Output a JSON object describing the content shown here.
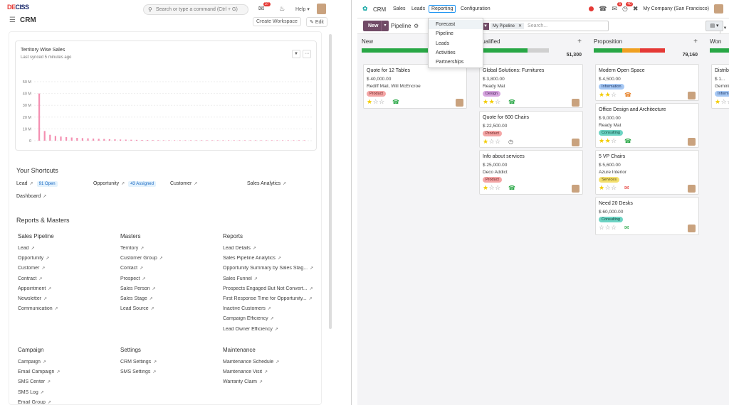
{
  "left": {
    "logo": {
      "text_a": "DE",
      "text_b": "CISS"
    },
    "search_placeholder": "Search or type a command (Ctrl + G)",
    "chat_badge": "37",
    "help_label": "Help",
    "page_title": "CRM",
    "create_workspace": "Create Workspace",
    "edit": "Edit",
    "chart": {
      "title": "Territory Wise Sales",
      "synced": "Last synced 5 minutes ago"
    },
    "shortcuts_title": "Your Shortcuts",
    "shortcuts": [
      {
        "label": "Lead",
        "badge": "91 Open"
      },
      {
        "label": "Opportunity",
        "badge": "43 Assigned"
      },
      {
        "label": "Customer"
      },
      {
        "label": "Sales Analytics"
      },
      {
        "label": "Dashboard"
      }
    ],
    "reports_title": "Reports & Masters",
    "groups": [
      {
        "title": "Sales Pipeline",
        "items": [
          "Lead",
          "Opportunity",
          "Customer",
          "Contract",
          "Appointment",
          "Newsletter",
          "Communication"
        ]
      },
      {
        "title": "Masters",
        "items": [
          "Territory",
          "Customer Group",
          "Contact",
          "Prospect",
          "Sales Person",
          "Sales Stage",
          "Lead Source"
        ]
      },
      {
        "title": "Reports",
        "items": [
          "Lead Details",
          "Sales Pipeline Analytics",
          "Opportunity Summary by Sales Stag...",
          "Sales Funnel",
          "Prospects Engaged But Not Convert...",
          "First Response Time for Opportunity...",
          "Inactive Customers",
          "Campaign Efficiency",
          "Lead Owner Efficiency"
        ]
      },
      {
        "title": "Campaign",
        "items": [
          "Campaign",
          "Email Campaign",
          "SMS Center",
          "SMS Log",
          "Email Group"
        ]
      },
      {
        "title": "Settings",
        "items": [
          "CRM Settings",
          "SMS Settings"
        ]
      },
      {
        "title": "Maintenance",
        "items": [
          "Maintenance Schedule",
          "Maintenance Visit",
          "Warranty Claim"
        ]
      }
    ]
  },
  "chart_data": {
    "type": "bar",
    "title": "Territory Wise Sales",
    "ylim": [
      0,
      50000000
    ],
    "y_ticks": [
      "50 M",
      "40 M",
      "30 M",
      "20 M",
      "10 M",
      "0"
    ],
    "values": [
      40000000,
      8200000,
      5000000,
      4000000,
      3500000,
      3000000,
      2700000,
      2400000,
      2200000,
      2000000,
      1800000,
      1600000,
      1450000,
      1300000,
      1150000,
      1000000,
      900000,
      800000,
      700000,
      620000,
      550000,
      480000,
      420000,
      370000,
      330000,
      290000,
      250000,
      220000,
      200000,
      180000,
      160000,
      140000,
      120000,
      100000,
      90000,
      80000,
      70000,
      60000,
      50000,
      45000,
      40000,
      35000,
      30000,
      25000,
      20000,
      15000,
      10000,
      8000,
      5000,
      3000
    ],
    "bar_color": "#f48fb1",
    "grid": true
  },
  "right": {
    "app": "CRM",
    "menu": [
      "Sales",
      "Leads",
      "Reporting",
      "Configuration"
    ],
    "dropdown": [
      "Forecast",
      "Pipeline",
      "Leads",
      "Activities",
      "Partnerships"
    ],
    "nav_badges": {
      "activity": "5",
      "messages": "40"
    },
    "company": "My Company (San Francisco)",
    "new": "New",
    "view_title": "Pipeline",
    "facet": "My Pipeline",
    "search_placeholder": "Search...",
    "columns": [
      {
        "name": "New",
        "total": "",
        "cards": [
          {
            "title": "Quote for 12 Tables",
            "revenue": "$ 40,000.00",
            "customer": "Rediff Mail, Will McEncroe",
            "tag": "Product",
            "tag_class": "t-product",
            "stars": 1,
            "act": "phone"
          }
        ]
      },
      {
        "name": "Qualified",
        "total": "51,300",
        "cards": [
          {
            "title": "Global Solutions: Furnitures",
            "revenue": "$ 3,800.00",
            "customer": "Ready Mat",
            "tag": "Design",
            "tag_class": "t-design",
            "stars": 2,
            "act": "phone"
          },
          {
            "title": "Quote for 600 Chairs",
            "revenue": "$ 22,500.00",
            "customer": "",
            "tag": "Product",
            "tag_class": "t-product",
            "stars": 1,
            "act": "clock"
          },
          {
            "title": "Info about services",
            "revenue": "$ 25,000.00",
            "customer": "Deco Addict",
            "tag": "Product",
            "tag_class": "t-product",
            "stars": 1,
            "act": "phone"
          }
        ]
      },
      {
        "name": "Proposition",
        "total": "79,160",
        "cards": [
          {
            "title": "Modern Open Space",
            "revenue": "$ 4,500.00",
            "customer": "",
            "tag": "Information",
            "tag_class": "t-info",
            "stars": 2,
            "act": "phone-o"
          },
          {
            "title": "Office Design and Architecture",
            "revenue": "$ 9,000.00",
            "customer": "Ready Mat",
            "tag": "Consulting",
            "tag_class": "t-consult",
            "stars": 2,
            "act": "phone"
          },
          {
            "title": "5 VP Chairs",
            "revenue": "$ 5,600.00",
            "customer": "Azure Interior",
            "tag": "Services",
            "tag_class": "t-services",
            "stars": 1,
            "act": "mail-r"
          },
          {
            "title": "Need 20 Desks",
            "revenue": "$ 60,000.00",
            "customer": "",
            "tag": "Consulting",
            "tag_class": "t-consult",
            "stars": 0,
            "act": "mail-g"
          }
        ]
      },
      {
        "name": "Won",
        "total": "",
        "cards": [
          {
            "title": "Distrib",
            "revenue": "$ 1...",
            "customer": "Gemini",
            "tag": "Inform",
            "tag_class": "t-info",
            "stars": 1,
            "act": ""
          }
        ]
      }
    ]
  }
}
